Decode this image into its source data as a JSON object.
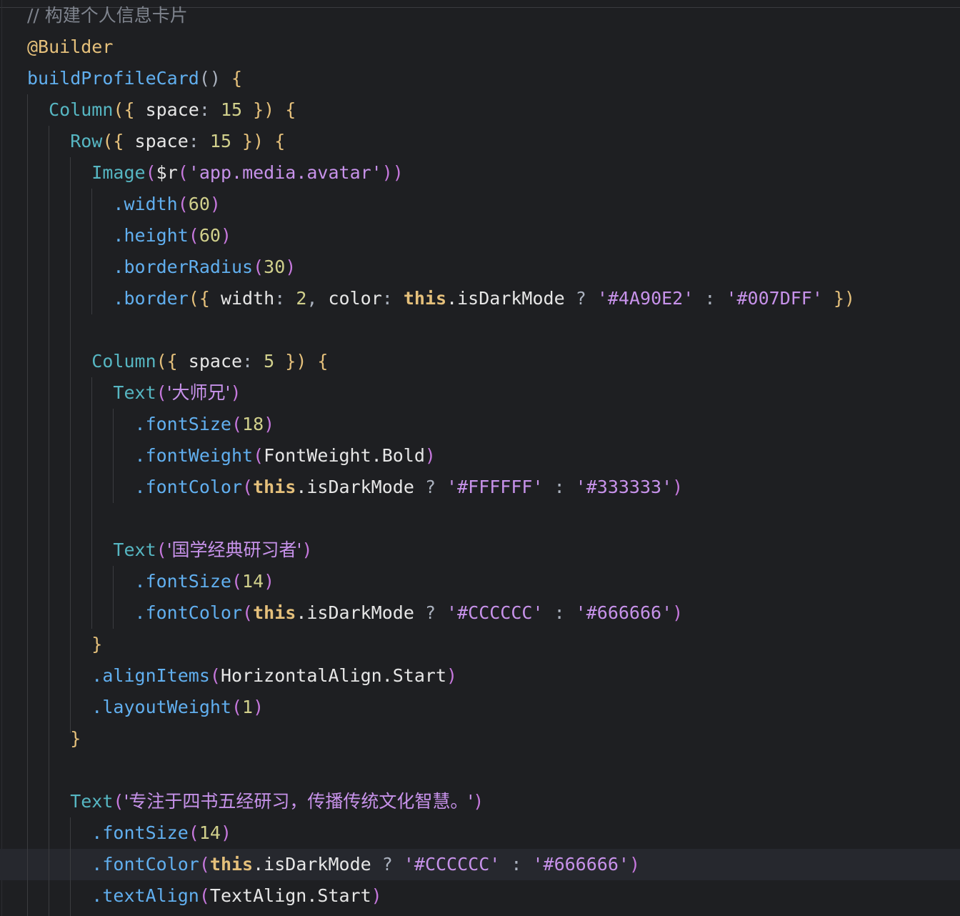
{
  "editor": {
    "lines": [
      {
        "tokens": [
          {
            "t": "// 构建个人信息卡片",
            "c": "comment"
          }
        ]
      },
      {
        "tokens": [
          {
            "t": "@Builder",
            "c": "deco"
          }
        ]
      },
      {
        "tokens": [
          {
            "t": "buildProfileCard",
            "c": "method"
          },
          {
            "t": "()",
            "c": "punct"
          },
          {
            "t": " {",
            "c": "brace"
          }
        ]
      },
      {
        "tokens": [
          {
            "t": "  Column",
            "c": "fn"
          },
          {
            "t": "({",
            "c": "brace"
          },
          {
            "t": " space",
            "c": "plain"
          },
          {
            "t": ": ",
            "c": "punct"
          },
          {
            "t": "15",
            "c": "num"
          },
          {
            "t": " })",
            "c": "brace"
          },
          {
            "t": " {",
            "c": "brace"
          }
        ]
      },
      {
        "tokens": [
          {
            "t": "    Row",
            "c": "fn"
          },
          {
            "t": "({",
            "c": "brace"
          },
          {
            "t": " space",
            "c": "plain"
          },
          {
            "t": ": ",
            "c": "punct"
          },
          {
            "t": "15",
            "c": "num"
          },
          {
            "t": " })",
            "c": "brace"
          },
          {
            "t": " {",
            "c": "brace"
          }
        ]
      },
      {
        "tokens": [
          {
            "t": "      Image",
            "c": "fn"
          },
          {
            "t": "(",
            "c": "paren"
          },
          {
            "t": "$r",
            "c": "plain"
          },
          {
            "t": "(",
            "c": "paren"
          },
          {
            "t": "'app.media.avatar'",
            "c": "str"
          },
          {
            "t": "))",
            "c": "paren"
          }
        ]
      },
      {
        "tokens": [
          {
            "t": "        .width",
            "c": "method"
          },
          {
            "t": "(",
            "c": "paren"
          },
          {
            "t": "60",
            "c": "num"
          },
          {
            "t": ")",
            "c": "paren"
          }
        ]
      },
      {
        "tokens": [
          {
            "t": "        .height",
            "c": "method"
          },
          {
            "t": "(",
            "c": "paren"
          },
          {
            "t": "60",
            "c": "num"
          },
          {
            "t": ")",
            "c": "paren"
          }
        ]
      },
      {
        "tokens": [
          {
            "t": "        .borderRadius",
            "c": "method"
          },
          {
            "t": "(",
            "c": "paren"
          },
          {
            "t": "30",
            "c": "num"
          },
          {
            "t": ")",
            "c": "paren"
          }
        ]
      },
      {
        "tokens": [
          {
            "t": "        .border",
            "c": "method"
          },
          {
            "t": "({",
            "c": "brace"
          },
          {
            "t": " width",
            "c": "plain"
          },
          {
            "t": ": ",
            "c": "punct"
          },
          {
            "t": "2",
            "c": "num"
          },
          {
            "t": ", ",
            "c": "punct"
          },
          {
            "t": "color",
            "c": "plain"
          },
          {
            "t": ": ",
            "c": "punct"
          },
          {
            "t": "this",
            "c": "kw"
          },
          {
            "t": ".isDarkMode",
            "c": "plain"
          },
          {
            "t": " ? ",
            "c": "punct"
          },
          {
            "t": "'#4A90E2'",
            "c": "str"
          },
          {
            "t": " : ",
            "c": "punct"
          },
          {
            "t": "'#007DFF'",
            "c": "str"
          },
          {
            "t": " })",
            "c": "brace"
          }
        ]
      },
      {
        "tokens": []
      },
      {
        "tokens": [
          {
            "t": "      Column",
            "c": "fn"
          },
          {
            "t": "({",
            "c": "brace"
          },
          {
            "t": " space",
            "c": "plain"
          },
          {
            "t": ": ",
            "c": "punct"
          },
          {
            "t": "5",
            "c": "num"
          },
          {
            "t": " })",
            "c": "brace"
          },
          {
            "t": " {",
            "c": "brace"
          }
        ]
      },
      {
        "tokens": [
          {
            "t": "        Text",
            "c": "fn"
          },
          {
            "t": "(",
            "c": "paren"
          },
          {
            "t": "'大师兄'",
            "c": "str"
          },
          {
            "t": ")",
            "c": "paren"
          }
        ]
      },
      {
        "tokens": [
          {
            "t": "          .fontSize",
            "c": "method"
          },
          {
            "t": "(",
            "c": "paren"
          },
          {
            "t": "18",
            "c": "num"
          },
          {
            "t": ")",
            "c": "paren"
          }
        ]
      },
      {
        "tokens": [
          {
            "t": "          .fontWeight",
            "c": "method"
          },
          {
            "t": "(",
            "c": "paren"
          },
          {
            "t": "FontWeight.Bold",
            "c": "plain"
          },
          {
            "t": ")",
            "c": "paren"
          }
        ]
      },
      {
        "tokens": [
          {
            "t": "          .fontColor",
            "c": "method"
          },
          {
            "t": "(",
            "c": "paren"
          },
          {
            "t": "this",
            "c": "kw"
          },
          {
            "t": ".isDarkMode",
            "c": "plain"
          },
          {
            "t": " ? ",
            "c": "punct"
          },
          {
            "t": "'#FFFFFF'",
            "c": "str"
          },
          {
            "t": " : ",
            "c": "punct"
          },
          {
            "t": "'#333333'",
            "c": "str"
          },
          {
            "t": ")",
            "c": "paren"
          }
        ]
      },
      {
        "tokens": []
      },
      {
        "tokens": [
          {
            "t": "        Text",
            "c": "fn"
          },
          {
            "t": "(",
            "c": "paren"
          },
          {
            "t": "'国学经典研习者'",
            "c": "str"
          },
          {
            "t": ")",
            "c": "paren"
          }
        ]
      },
      {
        "tokens": [
          {
            "t": "          .fontSize",
            "c": "method"
          },
          {
            "t": "(",
            "c": "paren"
          },
          {
            "t": "14",
            "c": "num"
          },
          {
            "t": ")",
            "c": "paren"
          }
        ]
      },
      {
        "tokens": [
          {
            "t": "          .fontColor",
            "c": "method"
          },
          {
            "t": "(",
            "c": "paren"
          },
          {
            "t": "this",
            "c": "kw"
          },
          {
            "t": ".isDarkMode",
            "c": "plain"
          },
          {
            "t": " ? ",
            "c": "punct"
          },
          {
            "t": "'#CCCCCC'",
            "c": "str"
          },
          {
            "t": " : ",
            "c": "punct"
          },
          {
            "t": "'#666666'",
            "c": "str"
          },
          {
            "t": ")",
            "c": "paren"
          }
        ]
      },
      {
        "tokens": [
          {
            "t": "      }",
            "c": "brace"
          }
        ]
      },
      {
        "tokens": [
          {
            "t": "      .alignItems",
            "c": "method"
          },
          {
            "t": "(",
            "c": "paren"
          },
          {
            "t": "HorizontalAlign.Start",
            "c": "plain"
          },
          {
            "t": ")",
            "c": "paren"
          }
        ]
      },
      {
        "tokens": [
          {
            "t": "      .layoutWeight",
            "c": "method"
          },
          {
            "t": "(",
            "c": "paren"
          },
          {
            "t": "1",
            "c": "num"
          },
          {
            "t": ")",
            "c": "paren"
          }
        ]
      },
      {
        "tokens": [
          {
            "t": "    }",
            "c": "brace"
          }
        ]
      },
      {
        "tokens": []
      },
      {
        "tokens": [
          {
            "t": "    Text",
            "c": "fn"
          },
          {
            "t": "(",
            "c": "paren"
          },
          {
            "t": "'专注于四书五经研习，传播传统文化智慧。'",
            "c": "str"
          },
          {
            "t": ")",
            "c": "paren"
          }
        ]
      },
      {
        "tokens": [
          {
            "t": "      .fontSize",
            "c": "method"
          },
          {
            "t": "(",
            "c": "paren"
          },
          {
            "t": "14",
            "c": "num"
          },
          {
            "t": ")",
            "c": "paren"
          }
        ]
      },
      {
        "tokens": [
          {
            "t": "      .fontColor",
            "c": "method"
          },
          {
            "t": "(",
            "c": "paren"
          },
          {
            "t": "this",
            "c": "kw"
          },
          {
            "t": ".isDarkMode",
            "c": "plain"
          },
          {
            "t": " ? ",
            "c": "punct"
          },
          {
            "t": "'#CCCCCC'",
            "c": "str"
          },
          {
            "t": " : ",
            "c": "punct"
          },
          {
            "t": "'#666666'",
            "c": "str"
          },
          {
            "t": ")",
            "c": "paren"
          }
        ]
      },
      {
        "tokens": [
          {
            "t": "      .textAlign",
            "c": "method"
          },
          {
            "t": "(",
            "c": "paren"
          },
          {
            "t": "TextAlign.Start",
            "c": "plain"
          },
          {
            "t": ")",
            "c": "paren"
          }
        ]
      }
    ]
  },
  "colors": {
    "background": "#1e1f22",
    "current_line": "#26282e",
    "comment": "#7f848e",
    "decorator": "#e5c07b",
    "component": "#56b6c2",
    "method": "#61afef",
    "number": "#d1d08c",
    "string": "#c792ea",
    "keyword": "#e5c07b"
  }
}
